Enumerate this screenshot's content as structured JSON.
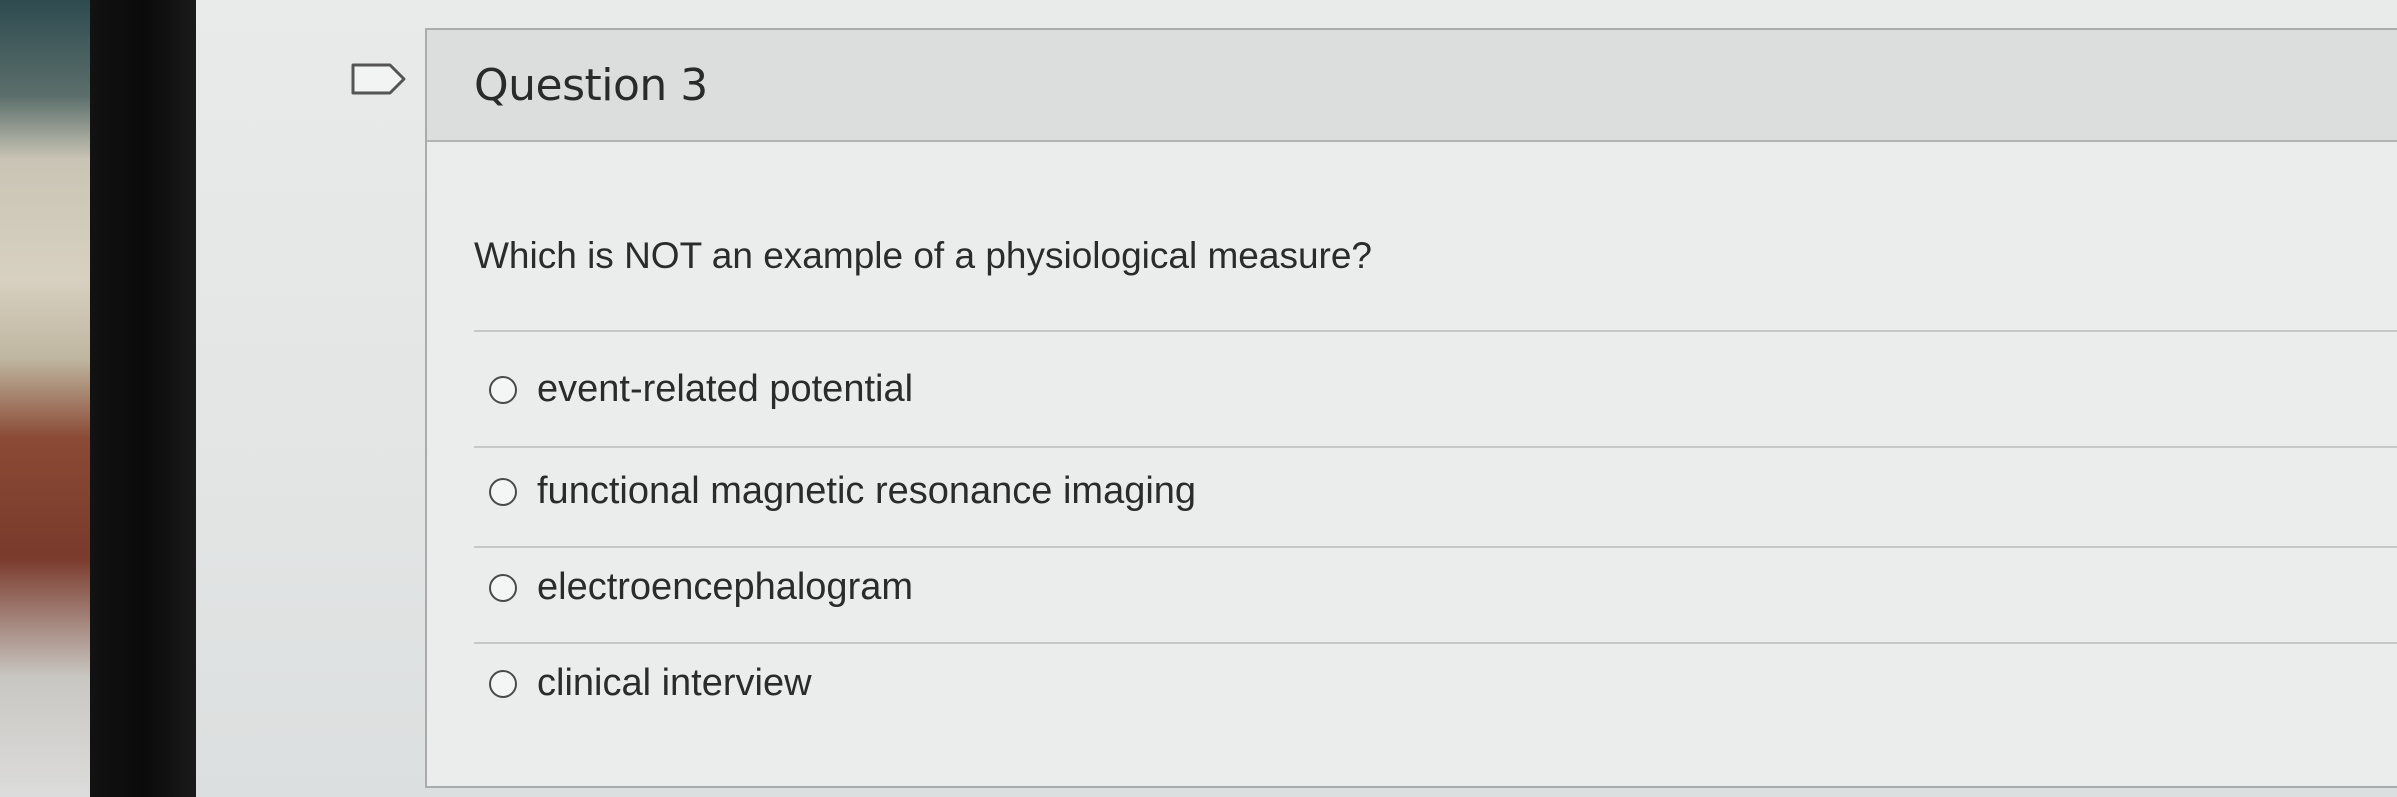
{
  "question": {
    "title": "Question 3",
    "prompt": "Which is NOT an example of a physiological measure?",
    "options": [
      {
        "label": "event-related potential",
        "selected": false
      },
      {
        "label": "functional magnetic resonance imaging",
        "selected": false
      },
      {
        "label": "electroencephalogram",
        "selected": false
      },
      {
        "label": "clinical interview",
        "selected": false
      }
    ]
  },
  "icons": {
    "bookmark": "bookmark-flag-icon",
    "radio": "radio-unchecked-icon"
  },
  "colors": {
    "text": "#2b2b2b",
    "header_bg": "#dcdede",
    "card_bg": "#ebeded",
    "border": "#a9acad"
  }
}
